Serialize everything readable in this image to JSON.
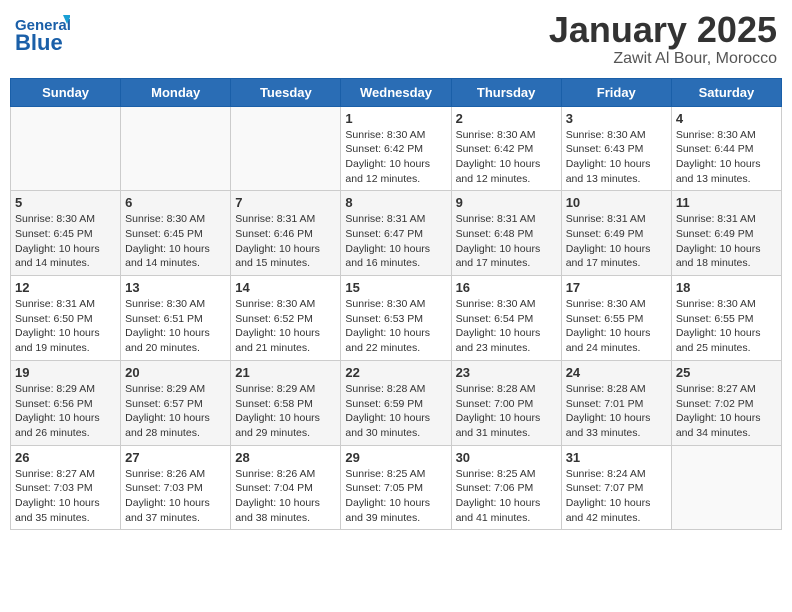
{
  "header": {
    "logo_general": "General",
    "logo_blue": "Blue",
    "month_year": "January 2025",
    "location": "Zawit Al Bour, Morocco"
  },
  "days_of_week": [
    "Sunday",
    "Monday",
    "Tuesday",
    "Wednesday",
    "Thursday",
    "Friday",
    "Saturday"
  ],
  "weeks": [
    {
      "cells": [
        {
          "day": "",
          "content": ""
        },
        {
          "day": "",
          "content": ""
        },
        {
          "day": "",
          "content": ""
        },
        {
          "day": "1",
          "content": "Sunrise: 8:30 AM\nSunset: 6:42 PM\nDaylight: 10 hours\nand 12 minutes."
        },
        {
          "day": "2",
          "content": "Sunrise: 8:30 AM\nSunset: 6:42 PM\nDaylight: 10 hours\nand 12 minutes."
        },
        {
          "day": "3",
          "content": "Sunrise: 8:30 AM\nSunset: 6:43 PM\nDaylight: 10 hours\nand 13 minutes."
        },
        {
          "day": "4",
          "content": "Sunrise: 8:30 AM\nSunset: 6:44 PM\nDaylight: 10 hours\nand 13 minutes."
        }
      ]
    },
    {
      "cells": [
        {
          "day": "5",
          "content": "Sunrise: 8:30 AM\nSunset: 6:45 PM\nDaylight: 10 hours\nand 14 minutes."
        },
        {
          "day": "6",
          "content": "Sunrise: 8:30 AM\nSunset: 6:45 PM\nDaylight: 10 hours\nand 14 minutes."
        },
        {
          "day": "7",
          "content": "Sunrise: 8:31 AM\nSunset: 6:46 PM\nDaylight: 10 hours\nand 15 minutes."
        },
        {
          "day": "8",
          "content": "Sunrise: 8:31 AM\nSunset: 6:47 PM\nDaylight: 10 hours\nand 16 minutes."
        },
        {
          "day": "9",
          "content": "Sunrise: 8:31 AM\nSunset: 6:48 PM\nDaylight: 10 hours\nand 17 minutes."
        },
        {
          "day": "10",
          "content": "Sunrise: 8:31 AM\nSunset: 6:49 PM\nDaylight: 10 hours\nand 17 minutes."
        },
        {
          "day": "11",
          "content": "Sunrise: 8:31 AM\nSunset: 6:49 PM\nDaylight: 10 hours\nand 18 minutes."
        }
      ]
    },
    {
      "cells": [
        {
          "day": "12",
          "content": "Sunrise: 8:31 AM\nSunset: 6:50 PM\nDaylight: 10 hours\nand 19 minutes."
        },
        {
          "day": "13",
          "content": "Sunrise: 8:30 AM\nSunset: 6:51 PM\nDaylight: 10 hours\nand 20 minutes."
        },
        {
          "day": "14",
          "content": "Sunrise: 8:30 AM\nSunset: 6:52 PM\nDaylight: 10 hours\nand 21 minutes."
        },
        {
          "day": "15",
          "content": "Sunrise: 8:30 AM\nSunset: 6:53 PM\nDaylight: 10 hours\nand 22 minutes."
        },
        {
          "day": "16",
          "content": "Sunrise: 8:30 AM\nSunset: 6:54 PM\nDaylight: 10 hours\nand 23 minutes."
        },
        {
          "day": "17",
          "content": "Sunrise: 8:30 AM\nSunset: 6:55 PM\nDaylight: 10 hours\nand 24 minutes."
        },
        {
          "day": "18",
          "content": "Sunrise: 8:30 AM\nSunset: 6:55 PM\nDaylight: 10 hours\nand 25 minutes."
        }
      ]
    },
    {
      "cells": [
        {
          "day": "19",
          "content": "Sunrise: 8:29 AM\nSunset: 6:56 PM\nDaylight: 10 hours\nand 26 minutes."
        },
        {
          "day": "20",
          "content": "Sunrise: 8:29 AM\nSunset: 6:57 PM\nDaylight: 10 hours\nand 28 minutes."
        },
        {
          "day": "21",
          "content": "Sunrise: 8:29 AM\nSunset: 6:58 PM\nDaylight: 10 hours\nand 29 minutes."
        },
        {
          "day": "22",
          "content": "Sunrise: 8:28 AM\nSunset: 6:59 PM\nDaylight: 10 hours\nand 30 minutes."
        },
        {
          "day": "23",
          "content": "Sunrise: 8:28 AM\nSunset: 7:00 PM\nDaylight: 10 hours\nand 31 minutes."
        },
        {
          "day": "24",
          "content": "Sunrise: 8:28 AM\nSunset: 7:01 PM\nDaylight: 10 hours\nand 33 minutes."
        },
        {
          "day": "25",
          "content": "Sunrise: 8:27 AM\nSunset: 7:02 PM\nDaylight: 10 hours\nand 34 minutes."
        }
      ]
    },
    {
      "cells": [
        {
          "day": "26",
          "content": "Sunrise: 8:27 AM\nSunset: 7:03 PM\nDaylight: 10 hours\nand 35 minutes."
        },
        {
          "day": "27",
          "content": "Sunrise: 8:26 AM\nSunset: 7:03 PM\nDaylight: 10 hours\nand 37 minutes."
        },
        {
          "day": "28",
          "content": "Sunrise: 8:26 AM\nSunset: 7:04 PM\nDaylight: 10 hours\nand 38 minutes."
        },
        {
          "day": "29",
          "content": "Sunrise: 8:25 AM\nSunset: 7:05 PM\nDaylight: 10 hours\nand 39 minutes."
        },
        {
          "day": "30",
          "content": "Sunrise: 8:25 AM\nSunset: 7:06 PM\nDaylight: 10 hours\nand 41 minutes."
        },
        {
          "day": "31",
          "content": "Sunrise: 8:24 AM\nSunset: 7:07 PM\nDaylight: 10 hours\nand 42 minutes."
        },
        {
          "day": "",
          "content": ""
        }
      ]
    }
  ]
}
